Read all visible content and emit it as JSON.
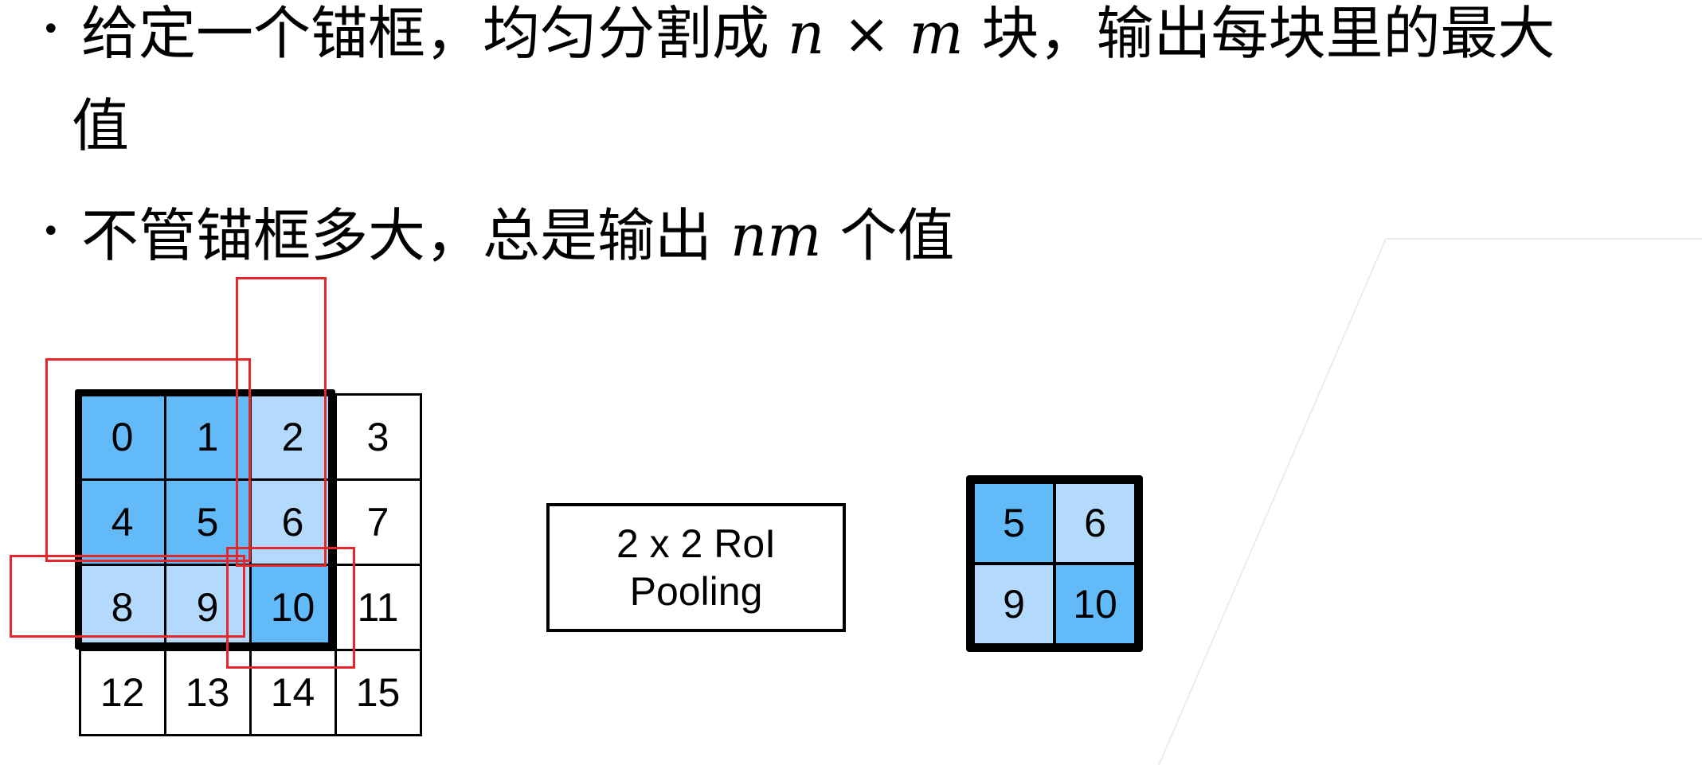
{
  "bullets": [
    {
      "before": "给定一个锚框，均匀分割成 ",
      "math": "n × m",
      "after": " 块，输出每块里的最大",
      "continuation": "值"
    },
    {
      "before": "不管锚框多大，总是输出 ",
      "math": "nm",
      "after": " 个值"
    }
  ],
  "input_grid": {
    "cells": [
      {
        "label": "0",
        "shade": "dark"
      },
      {
        "label": "1",
        "shade": "dark"
      },
      {
        "label": "2",
        "shade": "light"
      },
      {
        "label": "3",
        "shade": "none"
      },
      {
        "label": "4",
        "shade": "dark"
      },
      {
        "label": "5",
        "shade": "dark"
      },
      {
        "label": "6",
        "shade": "light"
      },
      {
        "label": "7",
        "shade": "none"
      },
      {
        "label": "8",
        "shade": "light"
      },
      {
        "label": "9",
        "shade": "light"
      },
      {
        "label": "10",
        "shade": "dark"
      },
      {
        "label": "11",
        "shade": "none"
      },
      {
        "label": "12",
        "shade": "none"
      },
      {
        "label": "13",
        "shade": "none"
      },
      {
        "label": "14",
        "shade": "none"
      },
      {
        "label": "15",
        "shade": "none"
      }
    ]
  },
  "operation": {
    "line1": "2 x 2 RoI",
    "line2": "Pooling"
  },
  "output_grid": {
    "cells": [
      {
        "label": "5",
        "shade": "dark"
      },
      {
        "label": "6",
        "shade": "light"
      },
      {
        "label": "9",
        "shade": "light"
      },
      {
        "label": "10",
        "shade": "dark"
      }
    ]
  },
  "colors": {
    "dark": "#62baf9",
    "light": "#b3d9fc",
    "red": "#e5262b"
  }
}
